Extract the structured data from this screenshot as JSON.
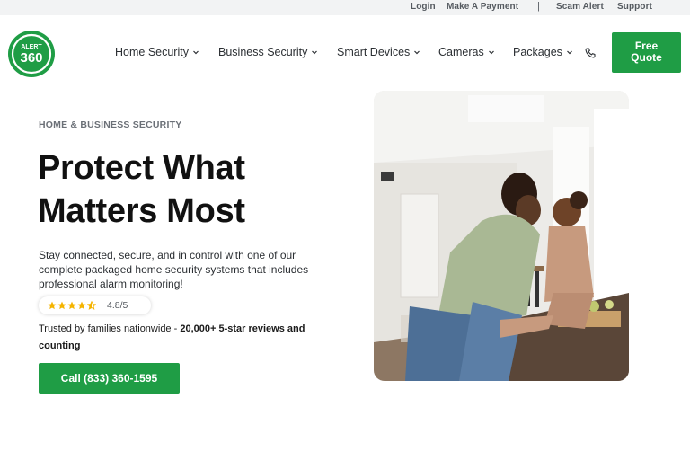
{
  "topbar": {
    "login": "Login",
    "payment": "Make A Payment",
    "separator": "|",
    "scam_alert": "Scam Alert",
    "support": "Support"
  },
  "logo": {
    "line1": "ALERT",
    "line2": "360"
  },
  "nav": {
    "items": [
      {
        "label": "Home Security"
      },
      {
        "label": "Business Security"
      },
      {
        "label": "Smart Devices"
      },
      {
        "label": "Cameras"
      },
      {
        "label": "Packages"
      }
    ],
    "quote_line1": "Free",
    "quote_line2": "Quote"
  },
  "hero": {
    "eyebrow": "HOME & BUSINESS SECURITY",
    "headline_line1": "Protect What",
    "headline_line2": "Matters Most",
    "description": "Stay connected, secure, and in control with one of our complete packaged home security systems that includes professional alarm monitoring!",
    "rating_value": "4.8/5",
    "rating_stars": 4.5,
    "trusted_prefix": "Trusted by families nationwide - ",
    "trusted_bold": "20,000+ 5-star reviews and counting",
    "call_label": "Call (833) 360-1595"
  },
  "colors": {
    "brand_green": "#1f9d45",
    "star_yellow": "#f5b400"
  },
  "icons": {
    "phone": "phone-icon",
    "chevron": "chevron-down-icon",
    "star": "star-icon"
  }
}
